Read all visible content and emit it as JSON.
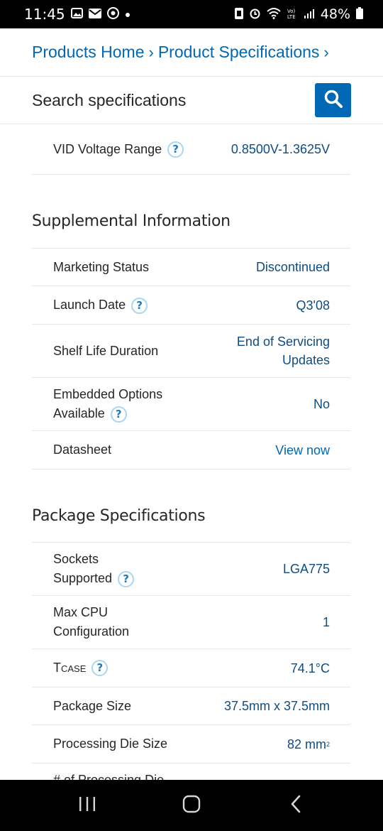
{
  "status": {
    "time": "11:45",
    "battery": "48%"
  },
  "breadcrumb": {
    "items": [
      "Products Home",
      "Product Specifications"
    ],
    "separator": "›"
  },
  "search": {
    "label": "Search specifications"
  },
  "help_glyph": "?",
  "top_row": {
    "label": "VID Voltage Range",
    "value": "0.8500V-1.3625V"
  },
  "supplemental": {
    "title": "Supplemental Information",
    "rows": [
      {
        "label": "Marketing Status",
        "value": "Discontinued"
      },
      {
        "label": "Launch Date",
        "value": "Q3'08"
      },
      {
        "label": "Shelf Life Duration",
        "value": "End of Servicing Updates"
      },
      {
        "label": "Embedded Options Available",
        "value": "No"
      },
      {
        "label": "Datasheet",
        "value": "View now"
      }
    ]
  },
  "package": {
    "title": "Package Specifications",
    "rows": [
      {
        "label": "Sockets Supported",
        "value": "LGA775"
      },
      {
        "label": "Max CPU Configuration",
        "value": "1"
      },
      {
        "label_main": "T",
        "label_sub": "CASE",
        "value": "74.1°C"
      },
      {
        "label": "Package Size",
        "value": "37.5mm x 37.5mm"
      },
      {
        "label": "Processing Die Size",
        "value": "82 mm",
        "value_sup": "2"
      },
      {
        "label": "# of Processing Die"
      }
    ]
  },
  "colors": {
    "link": "#0068b5",
    "value": "#0f4c81",
    "divider": "#e6e6e6",
    "help_border": "#a9d6f0"
  }
}
